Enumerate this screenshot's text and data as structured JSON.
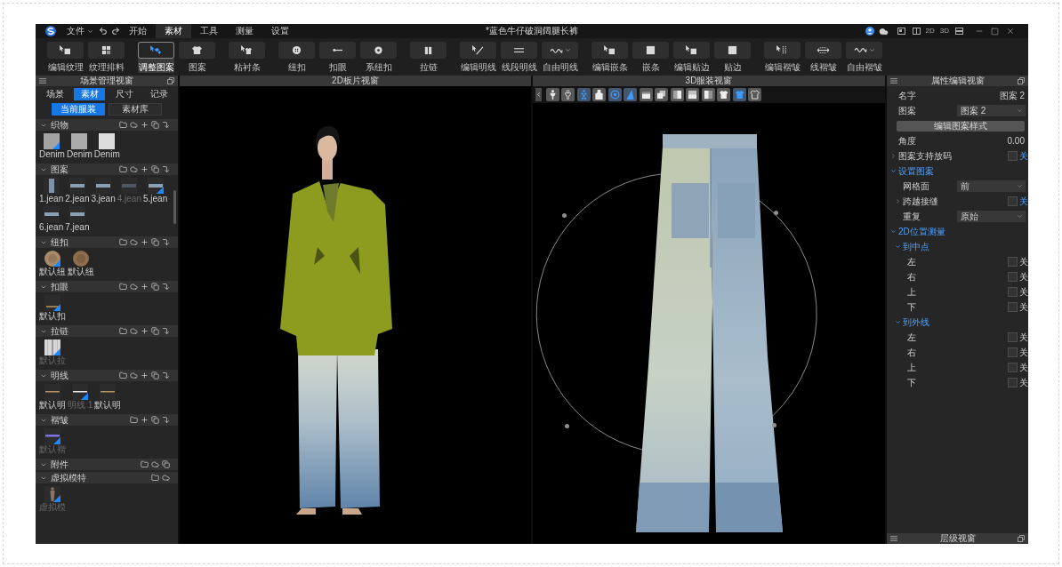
{
  "app": {
    "title": "*蓝色牛仔破洞阔腿长裤"
  },
  "menu": {
    "file": "文件",
    "tabs": [
      {
        "label": "开始",
        "selected": false
      },
      {
        "label": "素材",
        "selected": true
      },
      {
        "label": "工具",
        "selected": false
      },
      {
        "label": "测量",
        "selected": false
      },
      {
        "label": "设置",
        "selected": false
      }
    ],
    "view_labels": [
      "2D",
      "3D"
    ]
  },
  "toolbar": {
    "groups": [
      [
        {
          "label": "编辑纹理",
          "selected": false,
          "dropdown": false
        },
        {
          "label": "纹理排料",
          "selected": false,
          "dropdown": false
        }
      ],
      [
        {
          "label": "调整图案",
          "selected": true,
          "dropdown": false
        },
        {
          "label": "图案",
          "selected": false,
          "dropdown": false
        }
      ],
      [
        {
          "label": "粘衬条",
          "selected": false,
          "dropdown": false
        }
      ],
      [
        {
          "label": "纽扣",
          "selected": false,
          "dropdown": false
        },
        {
          "label": "扣眼",
          "selected": false,
          "dropdown": false
        },
        {
          "label": "系纽扣",
          "selected": false,
          "dropdown": false
        }
      ],
      [
        {
          "label": "拉链",
          "selected": false,
          "dropdown": false
        }
      ],
      [
        {
          "label": "编辑明线",
          "selected": false,
          "dropdown": false
        },
        {
          "label": "线段明线",
          "selected": false,
          "dropdown": false
        },
        {
          "label": "自由明线",
          "selected": false,
          "dropdown": true
        }
      ],
      [
        {
          "label": "编辑嵌条",
          "selected": false,
          "dropdown": false
        },
        {
          "label": "嵌条",
          "selected": false,
          "dropdown": false
        },
        {
          "label": "编辑贴边",
          "selected": false,
          "dropdown": false
        },
        {
          "label": "贴边",
          "selected": false,
          "dropdown": false
        }
      ],
      [
        {
          "label": "编辑褶皱",
          "selected": false,
          "dropdown": false
        },
        {
          "label": "线褶皱",
          "selected": false,
          "dropdown": false
        },
        {
          "label": "自由褶皱",
          "selected": false,
          "dropdown": true
        }
      ]
    ]
  },
  "scene_panel": {
    "title": "场景管理视窗",
    "tabs": [
      {
        "label": "场景",
        "selected": false
      },
      {
        "label": "素材",
        "selected": true
      },
      {
        "label": "尺寸",
        "selected": false
      },
      {
        "label": "记录",
        "selected": false
      }
    ],
    "subtabs": [
      {
        "label": "当前服装",
        "selected": true
      },
      {
        "label": "素材库",
        "selected": false
      }
    ],
    "sections": [
      {
        "title": "织物",
        "expanded": true,
        "actions": [
          {
            "kind": "folder"
          },
          {
            "kind": "cloud"
          },
          {
            "kind": "add"
          },
          {
            "kind": "copy"
          },
          {
            "kind": "export"
          }
        ],
        "items": [
          {
            "label": "Denim",
            "kind": "fabric",
            "color": "#a3a3a3",
            "applied": true,
            "disabled": false
          },
          {
            "label": "Denim",
            "kind": "fabric",
            "color": "#ababab",
            "applied": false,
            "disabled": false
          },
          {
            "label": "Denim",
            "kind": "fabric",
            "color": "#dcdcdc",
            "applied": false,
            "disabled": false
          }
        ]
      },
      {
        "title": "图案",
        "expanded": true,
        "actions": [
          {
            "kind": "folder"
          },
          {
            "kind": "cloud"
          },
          {
            "kind": "add"
          },
          {
            "kind": "copy"
          },
          {
            "kind": "export"
          }
        ],
        "items": [
          {
            "label": "1.jean",
            "kind": "graphic",
            "applied": false,
            "disabled": false
          },
          {
            "label": "2.jean",
            "kind": "graphic",
            "applied": false,
            "disabled": false
          },
          {
            "label": "3.jean",
            "kind": "graphic",
            "applied": false,
            "disabled": false
          },
          {
            "label": "4.jean",
            "kind": "graphic",
            "applied": false,
            "disabled": true
          },
          {
            "label": "5.jean",
            "kind": "graphic",
            "applied": true,
            "disabled": false
          },
          {
            "label": "6.jean",
            "kind": "graphic",
            "applied": false,
            "disabled": false
          },
          {
            "label": "7.jean",
            "kind": "graphic",
            "applied": false,
            "disabled": false
          }
        ]
      },
      {
        "title": "纽扣",
        "expanded": true,
        "actions": [
          {
            "kind": "folder"
          },
          {
            "kind": "cloud"
          },
          {
            "kind": "add"
          },
          {
            "kind": "copy"
          },
          {
            "kind": "export"
          }
        ],
        "items": [
          {
            "label": "默认纽",
            "kind": "button",
            "applied": true,
            "disabled": false
          },
          {
            "label": "默认纽",
            "kind": "button",
            "applied": false,
            "disabled": false
          }
        ]
      },
      {
        "title": "扣眼",
        "expanded": true,
        "actions": [
          {
            "kind": "folder"
          },
          {
            "kind": "cloud"
          },
          {
            "kind": "add"
          },
          {
            "kind": "copy"
          },
          {
            "kind": "export"
          }
        ],
        "items": [
          {
            "label": "默认扣",
            "kind": "buttonhole",
            "applied": true,
            "disabled": false
          }
        ]
      },
      {
        "title": "拉链",
        "expanded": true,
        "actions": [
          {
            "kind": "folder"
          },
          {
            "kind": "cloud"
          },
          {
            "kind": "add"
          },
          {
            "kind": "copy"
          },
          {
            "kind": "export"
          }
        ],
        "items": [
          {
            "label": "默认拉",
            "kind": "zipper",
            "applied": true,
            "disabled": true
          }
        ]
      },
      {
        "title": "明线",
        "expanded": true,
        "actions": [
          {
            "kind": "folder"
          },
          {
            "kind": "cloud"
          },
          {
            "kind": "add"
          },
          {
            "kind": "copy"
          },
          {
            "kind": "export"
          }
        ],
        "items": [
          {
            "label": "默认明",
            "kind": "stitch",
            "color": "#b0925e",
            "applied": false,
            "disabled": false
          },
          {
            "label": "明线 1",
            "kind": "stitch",
            "color": "#e4e4e4",
            "applied": true,
            "disabled": true
          },
          {
            "label": "默认明",
            "kind": "stitch",
            "color": "#b0925e",
            "applied": false,
            "disabled": false
          }
        ]
      },
      {
        "title": "褶皱",
        "expanded": true,
        "actions": [
          {
            "kind": "folder"
          },
          {
            "kind": "add"
          },
          {
            "kind": "copy"
          },
          {
            "kind": "export"
          }
        ],
        "items": [
          {
            "label": "默认褶",
            "kind": "fold",
            "color": "#7f72e6",
            "applied": true,
            "disabled": true
          }
        ]
      },
      {
        "title": "附件",
        "expanded": true,
        "actions": [
          {
            "kind": "folder"
          },
          {
            "kind": "cloud"
          },
          {
            "kind": "copy"
          }
        ]
      },
      {
        "title": "虚拟模特",
        "expanded": true,
        "actions": [
          {
            "kind": "folder"
          },
          {
            "kind": "cloud"
          }
        ],
        "items": [
          {
            "label": "虚拟模",
            "kind": "avatar",
            "applied": true,
            "disabled": true
          }
        ]
      }
    ]
  },
  "view_2d": {
    "title": "2D板片视窗"
  },
  "view_3d": {
    "title": "3D服装视窗",
    "tools": [
      {
        "on": false
      },
      {
        "on": false
      },
      {
        "on": true
      },
      {
        "on": false
      },
      {
        "on": true
      },
      {
        "on": true
      },
      {
        "on": false
      },
      {
        "on": false
      },
      {
        "on": false
      },
      {
        "on": false
      },
      {
        "on": false
      },
      {
        "on": false
      },
      {
        "on": true
      },
      {
        "on": false
      }
    ]
  },
  "property_panel": {
    "title": "属性编辑视窗",
    "rows": [
      {
        "kind": "text",
        "label": "名字",
        "value": "图案 2"
      },
      {
        "kind": "select",
        "label": "图案",
        "value": "图案 2"
      },
      {
        "kind": "button",
        "label": "编辑图案样式"
      },
      {
        "kind": "text",
        "label": "角度",
        "value": "0.00"
      },
      {
        "kind": "checkbox",
        "label": "图案支持放码",
        "expanded": false,
        "checked": false,
        "value": "关"
      },
      {
        "kind": "group",
        "label": "设置图案",
        "expanded": true,
        "children": [
          {
            "kind": "select",
            "label": "网格面",
            "value": "前"
          },
          {
            "kind": "checkbox",
            "label": "跨越接缝",
            "expanded": false,
            "checked": false,
            "value": "关"
          },
          {
            "kind": "select",
            "label": "重复",
            "value": "原始"
          }
        ]
      },
      {
        "kind": "group",
        "label": "2D位置测量",
        "expanded": true,
        "children": [
          {
            "kind": "group",
            "label": "到中点",
            "expanded": true,
            "children": [
              {
                "kind": "checkbox",
                "label": "左",
                "checked": false,
                "value": "关"
              },
              {
                "kind": "checkbox",
                "label": "右",
                "checked": false,
                "value": "关"
              },
              {
                "kind": "checkbox",
                "label": "上",
                "checked": false,
                "value": "关"
              },
              {
                "kind": "checkbox",
                "label": "下",
                "checked": false,
                "value": "关"
              }
            ]
          },
          {
            "kind": "group",
            "label": "到外线",
            "expanded": true,
            "children": [
              {
                "kind": "checkbox",
                "label": "左",
                "checked": false,
                "value": "关"
              },
              {
                "kind": "checkbox",
                "label": "右",
                "checked": false,
                "value": "关"
              },
              {
                "kind": "checkbox",
                "label": "上",
                "checked": false,
                "value": "关"
              },
              {
                "kind": "checkbox",
                "label": "下",
                "checked": false,
                "value": "关"
              }
            ]
          }
        ]
      }
    ]
  },
  "bottom_panel": {
    "title": "层级视窗"
  }
}
